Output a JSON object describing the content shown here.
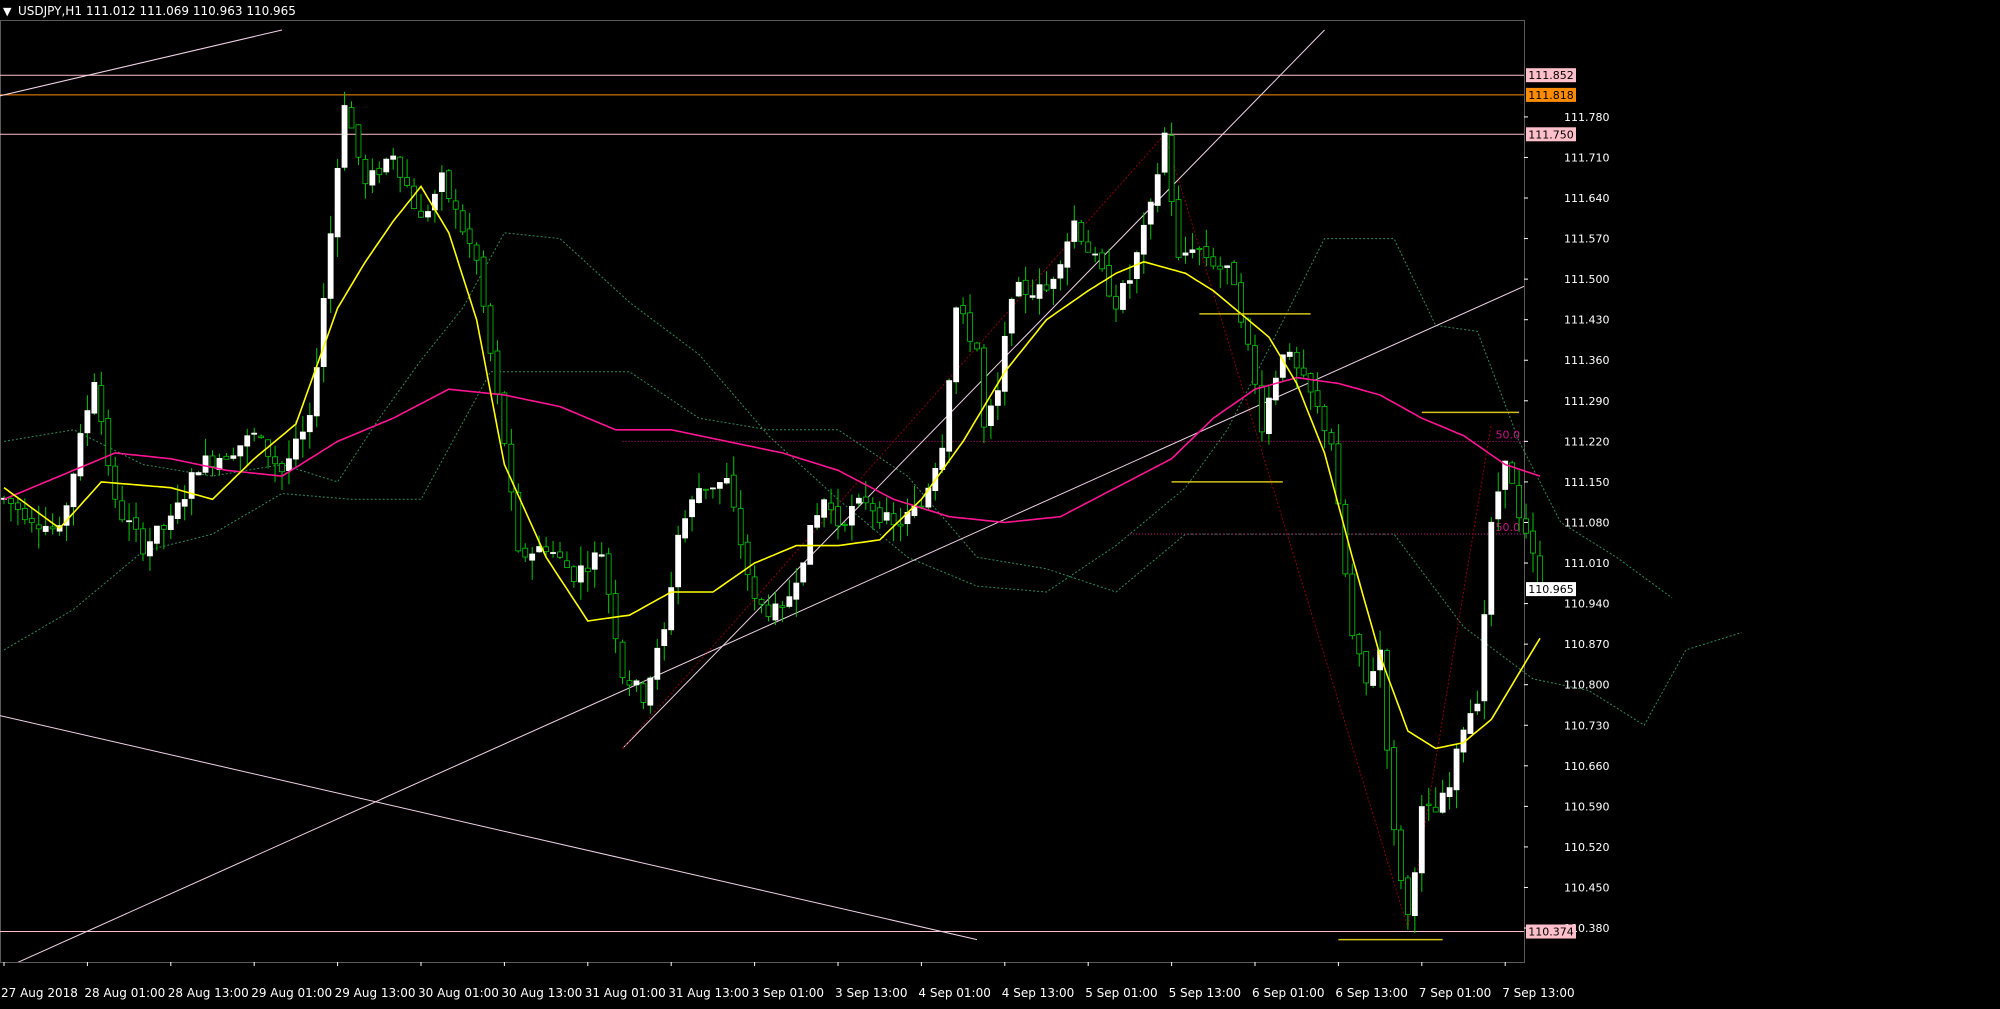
{
  "header": {
    "menu_glyph": "▼",
    "symbol": "USDJPY,H1",
    "ohlc": "111.012 111.069 110.963 110.965"
  },
  "colors": {
    "background": "#000000",
    "bull_candle": "#ffffff",
    "bear_candle": "#000000",
    "wick": "#00c800",
    "ma_fast": "#ffff00",
    "ma_slow": "#ff1493",
    "ichimoku": "#2e8b57",
    "trendline": "#f2d3e8",
    "hline": "#ffc0cb",
    "hline_orange": "#ff8c00",
    "fibo": "#c71585",
    "zigzag": "#8b0000",
    "level_mark": "#d4c21a",
    "price_box": "#ffffff"
  },
  "chart_data": {
    "type": "candlestick",
    "symbol": "USDJPY",
    "timeframe": "H1",
    "ylim": [
      110.33,
      111.93
    ],
    "y_ticks": [
      "111.780",
      "111.710",
      "111.640",
      "111.570",
      "111.500",
      "111.430",
      "111.360",
      "111.290",
      "111.220",
      "111.150",
      "111.080",
      "111.010",
      "110.940",
      "110.870",
      "110.800",
      "110.730",
      "110.660",
      "110.590",
      "110.520",
      "110.450",
      "110.380"
    ],
    "x_ticks": [
      {
        "bar": 0,
        "label": "27 Aug 2018"
      },
      {
        "bar": 12,
        "label": "28 Aug 01:00"
      },
      {
        "bar": 24,
        "label": "28 Aug 13:00"
      },
      {
        "bar": 36,
        "label": "29 Aug 01:00"
      },
      {
        "bar": 48,
        "label": "29 Aug 13:00"
      },
      {
        "bar": 60,
        "label": "30 Aug 01:00"
      },
      {
        "bar": 72,
        "label": "30 Aug 13:00"
      },
      {
        "bar": 84,
        "label": "31 Aug 01:00"
      },
      {
        "bar": 96,
        "label": "31 Aug 13:00"
      },
      {
        "bar": 108,
        "label": "3 Sep 01:00"
      },
      {
        "bar": 120,
        "label": "3 Sep 13:00"
      },
      {
        "bar": 132,
        "label": "4 Sep 01:00"
      },
      {
        "bar": 144,
        "label": "4 Sep 13:00"
      },
      {
        "bar": 156,
        "label": "5 Sep 01:00"
      },
      {
        "bar": 168,
        "label": "5 Sep 13:00"
      },
      {
        "bar": 180,
        "label": "6 Sep 01:00"
      },
      {
        "bar": 192,
        "label": "6 Sep 13:00"
      },
      {
        "bar": 204,
        "label": "7 Sep 01:00"
      },
      {
        "bar": 216,
        "label": "7 Sep 13:00"
      }
    ],
    "price_keypoints": [
      [
        0,
        111.12
      ],
      [
        4,
        111.09
      ],
      [
        8,
        111.06
      ],
      [
        13,
        111.33
      ],
      [
        16,
        111.11
      ],
      [
        20,
        111.04
      ],
      [
        24,
        111.08
      ],
      [
        28,
        111.18
      ],
      [
        32,
        111.2
      ],
      [
        36,
        111.23
      ],
      [
        40,
        111.17
      ],
      [
        44,
        111.25
      ],
      [
        47,
        111.58
      ],
      [
        49,
        111.81
      ],
      [
        52,
        111.66
      ],
      [
        56,
        111.72
      ],
      [
        60,
        111.6
      ],
      [
        63,
        111.67
      ],
      [
        68,
        111.53
      ],
      [
        70,
        111.37
      ],
      [
        72,
        111.22
      ],
      [
        74,
        111.02
      ],
      [
        78,
        111.04
      ],
      [
        82,
        110.99
      ],
      [
        86,
        111.03
      ],
      [
        89,
        110.82
      ],
      [
        92,
        110.78
      ],
      [
        95,
        110.89
      ],
      [
        97,
        111.06
      ],
      [
        100,
        111.14
      ],
      [
        104,
        111.15
      ],
      [
        108,
        110.94
      ],
      [
        112,
        110.92
      ],
      [
        116,
        111.06
      ],
      [
        118,
        111.12
      ],
      [
        120,
        111.08
      ],
      [
        124,
        111.12
      ],
      [
        128,
        111.07
      ],
      [
        132,
        111.11
      ],
      [
        135,
        111.22
      ],
      [
        137,
        111.45
      ],
      [
        140,
        111.38
      ],
      [
        141,
        111.24
      ],
      [
        143,
        111.3
      ],
      [
        145,
        111.48
      ],
      [
        150,
        111.48
      ],
      [
        154,
        111.6
      ],
      [
        157,
        111.53
      ],
      [
        160,
        111.46
      ],
      [
        162,
        111.5
      ],
      [
        165,
        111.62
      ],
      [
        167,
        111.75
      ],
      [
        169,
        111.53
      ],
      [
        171,
        111.56
      ],
      [
        174,
        111.53
      ],
      [
        177,
        111.5
      ],
      [
        179,
        111.38
      ],
      [
        181,
        111.25
      ],
      [
        184,
        111.38
      ],
      [
        188,
        111.3
      ],
      [
        191,
        111.22
      ],
      [
        192,
        111.1
      ],
      [
        194,
        110.88
      ],
      [
        196,
        110.8
      ],
      [
        198,
        110.86
      ],
      [
        200,
        110.54
      ],
      [
        202,
        110.4
      ],
      [
        204,
        110.58
      ],
      [
        206,
        110.58
      ],
      [
        208,
        110.62
      ],
      [
        210,
        110.73
      ],
      [
        212,
        110.78
      ],
      [
        214,
        111.07
      ],
      [
        216,
        111.2
      ],
      [
        218,
        111.08
      ],
      [
        220,
        111.02
      ],
      [
        221,
        110.965
      ]
    ],
    "ma_fast_period_label": "",
    "ma_fast": [
      [
        0,
        111.14
      ],
      [
        8,
        111.07
      ],
      [
        14,
        111.15
      ],
      [
        24,
        111.14
      ],
      [
        30,
        111.12
      ],
      [
        36,
        111.19
      ],
      [
        42,
        111.25
      ],
      [
        48,
        111.45
      ],
      [
        52,
        111.53
      ],
      [
        56,
        111.6
      ],
      [
        60,
        111.66
      ],
      [
        64,
        111.58
      ],
      [
        68,
        111.43
      ],
      [
        72,
        111.18
      ],
      [
        78,
        111.02
      ],
      [
        84,
        110.91
      ],
      [
        90,
        110.92
      ],
      [
        96,
        110.96
      ],
      [
        102,
        110.96
      ],
      [
        108,
        111.01
      ],
      [
        114,
        111.04
      ],
      [
        120,
        111.04
      ],
      [
        126,
        111.05
      ],
      [
        132,
        111.12
      ],
      [
        138,
        111.22
      ],
      [
        144,
        111.34
      ],
      [
        150,
        111.43
      ],
      [
        156,
        111.48
      ],
      [
        160,
        111.51
      ],
      [
        164,
        111.53
      ],
      [
        170,
        111.51
      ],
      [
        174,
        111.48
      ],
      [
        178,
        111.44
      ],
      [
        182,
        111.4
      ],
      [
        186,
        111.32
      ],
      [
        190,
        111.2
      ],
      [
        194,
        111.02
      ],
      [
        198,
        110.85
      ],
      [
        202,
        110.72
      ],
      [
        206,
        110.69
      ],
      [
        210,
        110.7
      ],
      [
        214,
        110.74
      ],
      [
        218,
        110.82
      ],
      [
        221,
        110.88
      ]
    ],
    "ma_slow": [
      [
        0,
        111.12
      ],
      [
        8,
        111.16
      ],
      [
        16,
        111.2
      ],
      [
        24,
        111.19
      ],
      [
        32,
        111.17
      ],
      [
        40,
        111.16
      ],
      [
        48,
        111.22
      ],
      [
        56,
        111.26
      ],
      [
        64,
        111.31
      ],
      [
        72,
        111.3
      ],
      [
        80,
        111.28
      ],
      [
        88,
        111.24
      ],
      [
        96,
        111.24
      ],
      [
        104,
        111.22
      ],
      [
        112,
        111.2
      ],
      [
        120,
        111.17
      ],
      [
        128,
        111.12
      ],
      [
        136,
        111.09
      ],
      [
        144,
        111.08
      ],
      [
        152,
        111.09
      ],
      [
        160,
        111.14
      ],
      [
        168,
        111.19
      ],
      [
        174,
        111.26
      ],
      [
        180,
        111.31
      ],
      [
        186,
        111.33
      ],
      [
        192,
        111.32
      ],
      [
        198,
        111.3
      ],
      [
        204,
        111.26
      ],
      [
        210,
        111.23
      ],
      [
        216,
        111.18
      ],
      [
        221,
        111.16
      ]
    ],
    "ichimoku_a": [
      [
        0,
        111.22
      ],
      [
        10,
        111.24
      ],
      [
        20,
        111.18
      ],
      [
        30,
        111.16
      ],
      [
        40,
        111.18
      ],
      [
        48,
        111.15
      ],
      [
        54,
        111.26
      ],
      [
        60,
        111.36
      ],
      [
        66,
        111.45
      ],
      [
        72,
        111.58
      ],
      [
        80,
        111.57
      ],
      [
        90,
        111.46
      ],
      [
        100,
        111.37
      ],
      [
        110,
        111.23
      ],
      [
        120,
        111.12
      ],
      [
        130,
        111.02
      ],
      [
        140,
        110.97
      ],
      [
        150,
        110.96
      ],
      [
        160,
        111.04
      ],
      [
        170,
        111.14
      ],
      [
        176,
        111.24
      ],
      [
        182,
        111.38
      ],
      [
        190,
        111.57
      ],
      [
        200,
        111.57
      ],
      [
        206,
        111.42
      ],
      [
        212,
        111.41
      ],
      [
        218,
        111.22
      ],
      [
        224,
        111.08
      ],
      [
        232,
        111.02
      ],
      [
        240,
        110.95
      ]
    ],
    "ichimoku_b": [
      [
        0,
        110.86
      ],
      [
        10,
        110.93
      ],
      [
        20,
        111.03
      ],
      [
        30,
        111.06
      ],
      [
        40,
        111.13
      ],
      [
        50,
        111.12
      ],
      [
        60,
        111.12
      ],
      [
        70,
        111.34
      ],
      [
        80,
        111.34
      ],
      [
        90,
        111.34
      ],
      [
        100,
        111.26
      ],
      [
        110,
        111.24
      ],
      [
        120,
        111.24
      ],
      [
        130,
        111.16
      ],
      [
        140,
        111.02
      ],
      [
        150,
        111.0
      ],
      [
        160,
        110.96
      ],
      [
        170,
        111.06
      ],
      [
        180,
        111.06
      ],
      [
        190,
        111.06
      ],
      [
        200,
        111.06
      ],
      [
        210,
        110.9
      ],
      [
        220,
        110.81
      ],
      [
        228,
        110.79
      ],
      [
        236,
        110.73
      ],
      [
        242,
        110.86
      ],
      [
        250,
        110.89
      ]
    ],
    "horizontal_levels": [
      {
        "price": "111.852",
        "color": "hline",
        "label_style": "pink"
      },
      {
        "price": "111.818",
        "color": "hline_orange",
        "label_style": "orange"
      },
      {
        "price": "111.750",
        "color": "hline",
        "label_style": "pink"
      },
      {
        "price": "110.374",
        "color": "hline",
        "label_style": "pink"
      }
    ],
    "current_price": "110.965",
    "fibo_levels": [
      {
        "label": "50.0",
        "price": 111.22,
        "from_bar": 89
      },
      {
        "label": "50.0",
        "price": 111.06,
        "from_bar": 162
      }
    ],
    "trendlines": [
      {
        "a": [
          -10,
          111.79
        ],
        "b": [
          40,
          111.93
        ]
      },
      {
        "a": [
          -20,
          110.8
        ],
        "b": [
          140,
          110.36
        ]
      },
      {
        "a": [
          89,
          110.69
        ],
        "b": [
          190,
          111.93
        ]
      },
      {
        "a": [
          0,
          110.31
        ],
        "b": [
          234,
          111.57
        ]
      }
    ],
    "zigzag": [
      [
        89,
        110.69
      ],
      [
        167,
        111.75
      ],
      [
        202,
        110.38
      ],
      [
        214,
        111.25
      ]
    ],
    "level_marks": [
      {
        "price": 111.44,
        "from_bar": 172,
        "to_bar": 188
      },
      {
        "price": 111.15,
        "from_bar": 168,
        "to_bar": 184
      },
      {
        "price": 111.27,
        "from_bar": 204,
        "to_bar": 218
      },
      {
        "price": 110.36,
        "from_bar": 192,
        "to_bar": 207
      }
    ]
  }
}
